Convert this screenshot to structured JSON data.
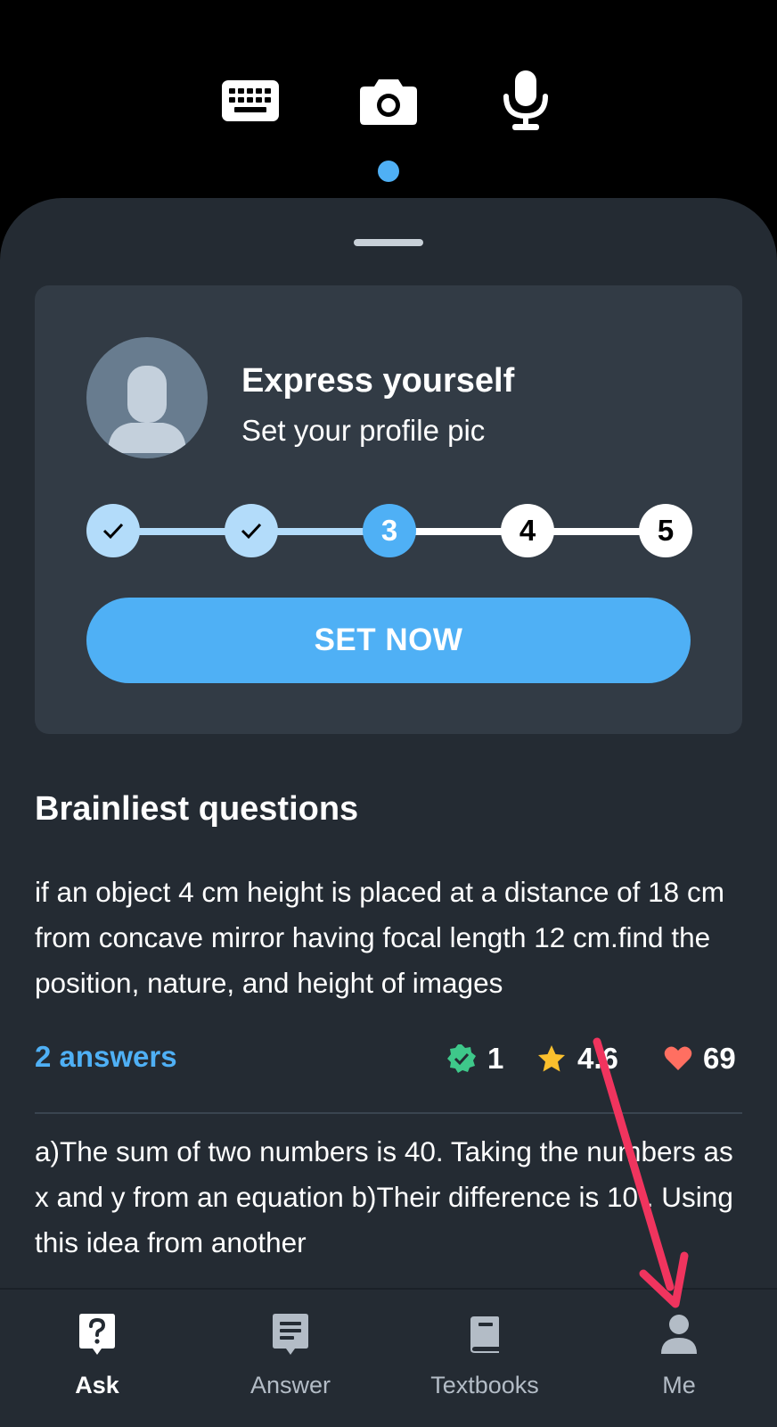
{
  "input_modes": [
    {
      "name": "keyboard-icon"
    },
    {
      "name": "camera-icon"
    },
    {
      "name": "microphone-icon"
    }
  ],
  "profile_card": {
    "title": "Express yourself",
    "subtitle": "Set your profile pic",
    "steps": [
      {
        "label": "",
        "state": "done"
      },
      {
        "label": "",
        "state": "done"
      },
      {
        "label": "3",
        "state": "current"
      },
      {
        "label": "4",
        "state": "todo"
      },
      {
        "label": "5",
        "state": "todo"
      }
    ],
    "button_label": "SET NOW"
  },
  "section_title": "Brainliest questions",
  "questions": [
    {
      "text": "if an object 4 cm height is placed at a distance of 18 cm from concave mirror having focal length 12 cm.find the position, nature, and height of images",
      "answers_label": "2 answers",
      "verified_count": "1",
      "rating": "4.6",
      "likes": "69"
    },
    {
      "text": "a)The sum of two numbers is 40. Taking the numbers as x and y from an equation b)Their difference is 10 . Using this idea from another"
    }
  ],
  "tabs": [
    {
      "label": "Ask",
      "icon": "ask-icon",
      "active": true
    },
    {
      "label": "Answer",
      "icon": "answer-icon",
      "active": false
    },
    {
      "label": "Textbooks",
      "icon": "textbook-icon",
      "active": false
    },
    {
      "label": "Me",
      "icon": "profile-icon",
      "active": false
    }
  ],
  "colors": {
    "accent": "#4fb0f5",
    "sheet_bg": "#242b33",
    "card_bg": "#323b45",
    "annotation_arrow": "#f0345e"
  }
}
